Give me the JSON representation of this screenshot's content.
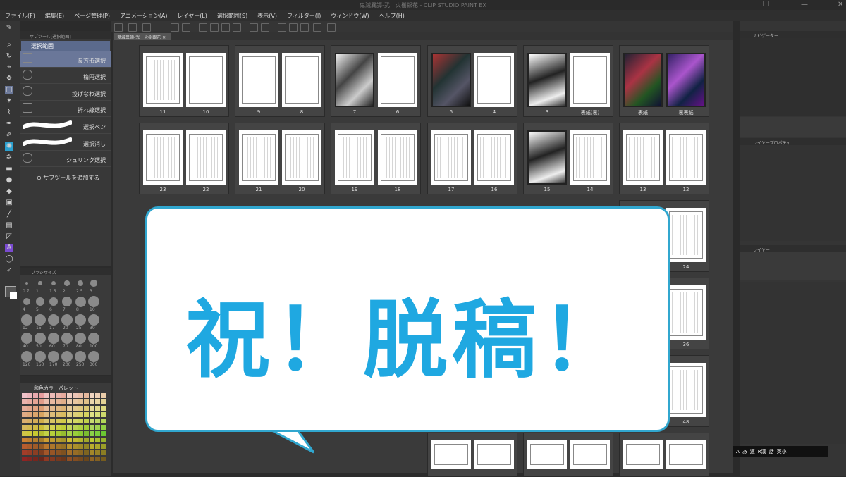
{
  "window": {
    "title": "鬼滅異譚-弐　火樹銀花 - CLIP STUDIO PAINT EX"
  },
  "menu": [
    "ファイル(F)",
    "編集(E)",
    "ページ管理(P)",
    "アニメーション(A)",
    "レイヤー(L)",
    "選択範囲(S)",
    "表示(V)",
    "フィルター(I)",
    "ウィンドウ(W)",
    "ヘルプ(H)"
  ],
  "subtool": {
    "header": "サブツール[選択範囲]",
    "group": "選択範囲",
    "items": [
      "長方形選択",
      "楕円選択",
      "投げなわ選択",
      "折れ線選択",
      "選択ペン",
      "選択消し",
      "シュリンク選択"
    ],
    "add_label": "サブツールを追加する"
  },
  "brush": {
    "header": "ブラシサイズ",
    "sizes": [
      "0.7",
      "1",
      "1.5",
      "2",
      "2.5",
      "3",
      "4",
      "5",
      "6",
      "7",
      "8",
      "10",
      "12",
      "15",
      "17",
      "20",
      "25",
      "30",
      "40",
      "50",
      "60",
      "70",
      "80",
      "100",
      "120",
      "150",
      "170",
      "200",
      "250",
      "300"
    ]
  },
  "palette": {
    "name": "和色カラーパレット"
  },
  "tabs": {
    "doc_tab": "鬼滅異譚-弐　火樹銀花"
  },
  "pages": {
    "row1": [
      "11",
      "10",
      "9",
      "8",
      "7",
      "6",
      "5",
      "4",
      "3",
      "表紙(裏)",
      "表紙",
      "裏表紙"
    ],
    "row2": [
      "23",
      "22",
      "21",
      "20",
      "19",
      "18",
      "17",
      "16",
      "15",
      "14",
      "13",
      "12"
    ],
    "right_visible": [
      "24",
      "36",
      "48"
    ]
  },
  "right_panel": {
    "navigator": "ナビゲーター",
    "layer_property": "レイヤープロパティ",
    "layer": "レイヤー"
  },
  "ime": {
    "items": [
      "A",
      "あ",
      "連",
      "R漢",
      "話",
      "英小"
    ]
  },
  "overlay": {
    "text": "祝！脱稿！",
    "color": "#1fa8e1",
    "border_color": "#31a7cf"
  }
}
